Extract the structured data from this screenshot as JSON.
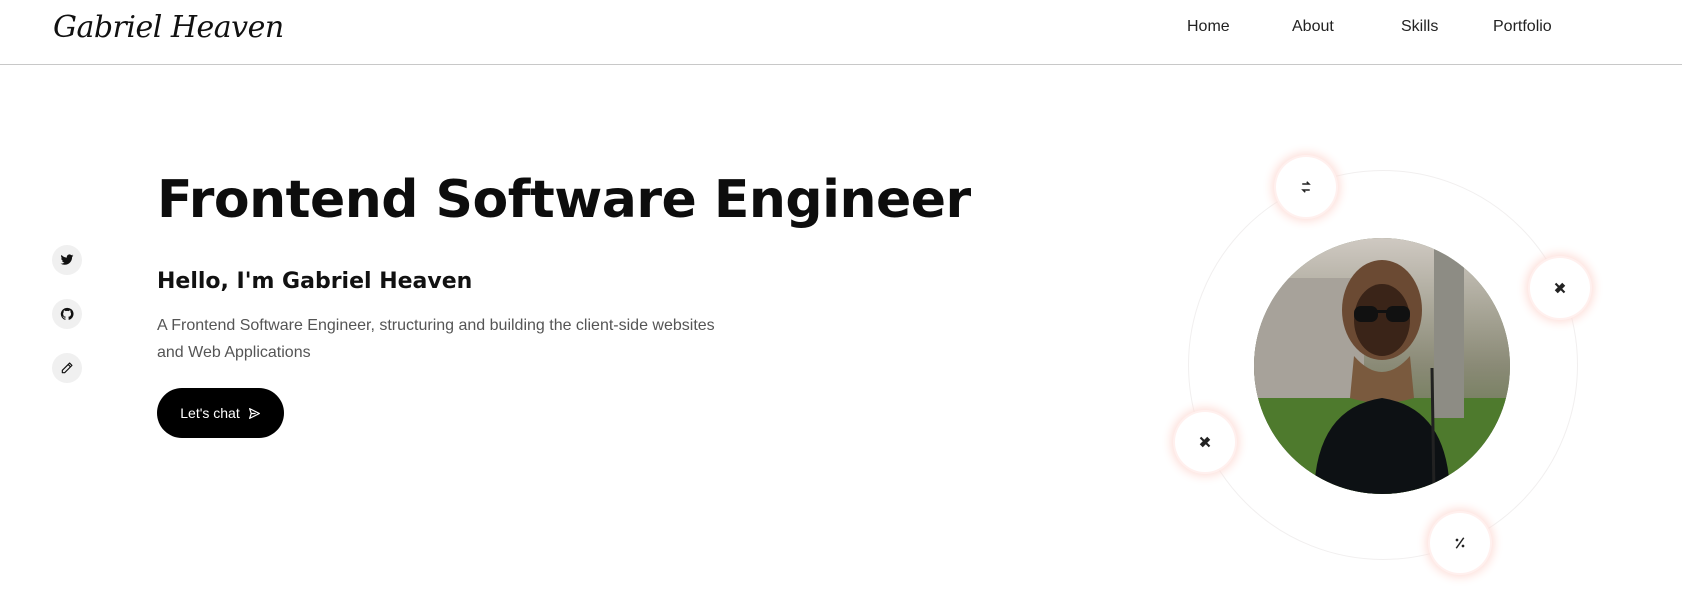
{
  "header": {
    "logo": "Gabriel Heaven",
    "nav": [
      {
        "label": "Home"
      },
      {
        "label": "About"
      },
      {
        "label": "Skills"
      },
      {
        "label": "Portfolio"
      }
    ]
  },
  "social": [
    {
      "icon": "twitter-icon"
    },
    {
      "icon": "github-icon"
    },
    {
      "icon": "pencil-icon"
    }
  ],
  "hero": {
    "title": "Frontend Software Engineer",
    "subtitle": "Hello, I'm Gabriel Heaven",
    "description": "A Frontend Software Engineer, structuring and building the client-side websites and Web Applications",
    "cta_label": "Let's chat",
    "cta_icon": "send-icon"
  },
  "orbit_icons": [
    "swap-icon",
    "tools-icon",
    "tools-icon",
    "percent-icon"
  ],
  "colors": {
    "accent": "#000000",
    "orbit_glow": "#fddcd6",
    "text_muted": "#555555"
  }
}
